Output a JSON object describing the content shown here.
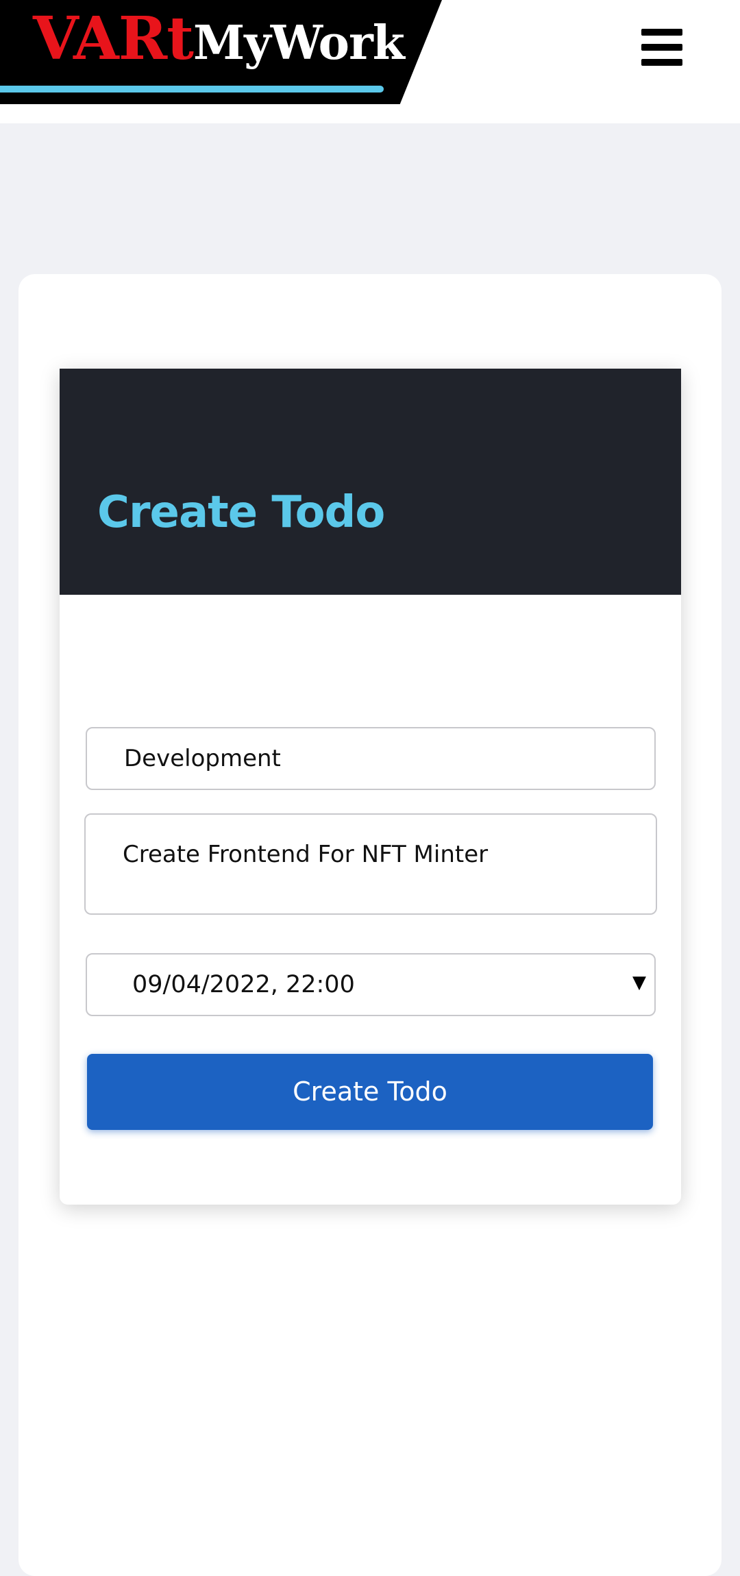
{
  "header": {
    "logo_part1": "VARt",
    "logo_part2": "MyWork",
    "menu_icon": "hamburger-menu-icon"
  },
  "form": {
    "title": "Create Todo",
    "category_value": "Development",
    "description_value": "Create Frontend For NFT Minter",
    "datetime_value": "09/04/2022, 22:00",
    "dropdown_icon": "triangle-down-icon",
    "submit_label": "Create Todo"
  },
  "colors": {
    "page_background": "#f0f1f5",
    "logo_red": "#e8141b",
    "accent_cyan": "#5bc8ea",
    "form_header_dark": "#20232b",
    "button_blue": "#1c62c2"
  }
}
